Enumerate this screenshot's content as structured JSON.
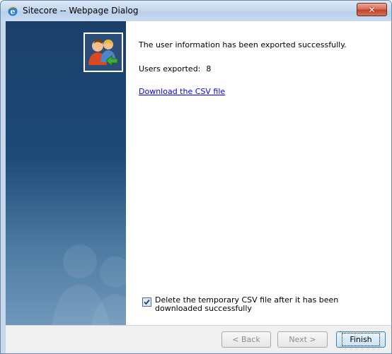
{
  "window": {
    "title": "Sitecore -- Webpage Dialog",
    "close_label": "✕"
  },
  "content": {
    "message": "The user information has been exported successfully.",
    "users_exported_label": "Users exported:",
    "users_exported_count": "8",
    "download_link": "Download the CSV file",
    "delete_temp_checked": true,
    "delete_temp_label": "Delete the temporary CSV file after it has been downloaded successfully"
  },
  "footer": {
    "back_label": "< Back",
    "next_label": "Next >",
    "finish_label": "Finish"
  },
  "colors": {
    "sidebar_top": "#1b3f6a",
    "sidebar_bottom": "#6f97bb",
    "link": "#0000ff",
    "close_button": "#c24428"
  }
}
